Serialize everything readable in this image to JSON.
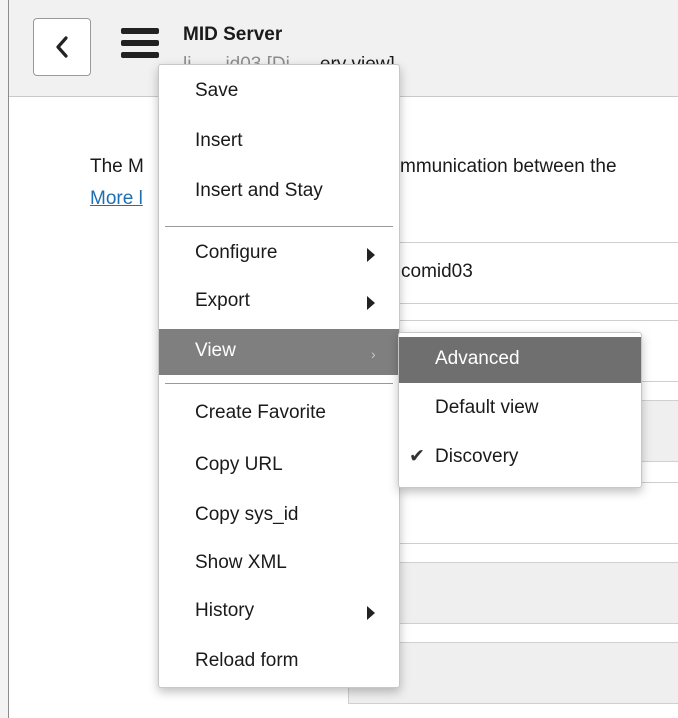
{
  "header": {
    "title": "MID Server",
    "subtitle_left": "li",
    "subtitle_mid": "id03 [Di",
    "subtitle_right": "ery view]"
  },
  "content": {
    "intro_left": "The M",
    "intro_right": "mmunication between the",
    "more_link": "More l",
    "name_value": "comid03"
  },
  "menu": {
    "items": [
      {
        "label": "Save"
      },
      {
        "label": "Insert"
      },
      {
        "label": "Insert and Stay"
      },
      {
        "label": "Configure",
        "submenu": true
      },
      {
        "label": "Export",
        "submenu": true
      },
      {
        "label": "View",
        "submenu": true,
        "active": true
      },
      {
        "label": "Create Favorite"
      },
      {
        "label": "Copy URL"
      },
      {
        "label": "Copy sys_id"
      },
      {
        "label": "Show XML"
      },
      {
        "label": "History",
        "submenu": true
      },
      {
        "label": "Reload form"
      }
    ]
  },
  "view_submenu": {
    "items": [
      {
        "label": "Advanced",
        "highlighted": true
      },
      {
        "label": "Default view"
      },
      {
        "label": "Discovery",
        "checked": true
      }
    ]
  },
  "icons": {
    "back": "chevron-left-icon",
    "menu": "hamburger-icon",
    "submenu_arrow": "caret-right-icon",
    "check": "checkmark-icon"
  },
  "colors": {
    "header_bg": "#f1f1f1",
    "menu_active": "#7f7f7f",
    "link": "#1f6fb0"
  }
}
